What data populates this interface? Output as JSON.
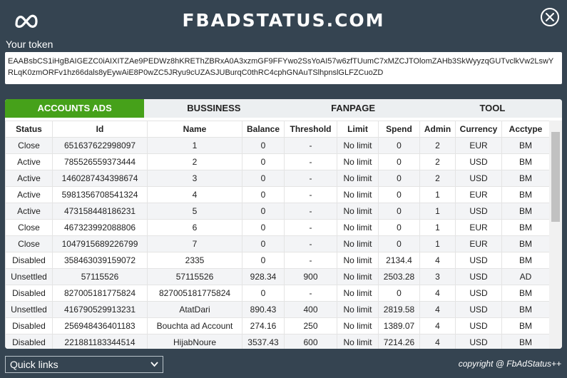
{
  "app": {
    "title": "FBADSTATUS.COM"
  },
  "token": {
    "label": "Your token",
    "value": "EAABsbCS1iHgBAIGEZC0iAIXITZAe9PEDWz8hKREThZBRxA0A3xzmGF9FFYwo2SsYoAI57w6zfTUumC7xMZCJTOlomZAHb3SkWyyzqGUTvclkVw2LswYRLqK0zmORFv1hz66dals8yEywAiE8P0wZC5JRyu9cUZASJUBurqC0thRC4cphGNAuTSlhpnslGLFZCuoZD"
  },
  "tabs": [
    "ACCOUNTS ADS",
    "BUSSINESS",
    "FANPAGE",
    "TOOL"
  ],
  "table": {
    "columns": [
      "Status",
      "Id",
      "Name",
      "Balance",
      "Threshold",
      "Limit",
      "Spend",
      "Admin",
      "Currency",
      "Acctype"
    ],
    "rows": [
      [
        "Close",
        "651637622998097",
        "1",
        "0",
        "-",
        "No limit",
        "0",
        "2",
        "EUR",
        "BM"
      ],
      [
        "Active",
        "785526559373444",
        "2",
        "0",
        "-",
        "No limit",
        "0",
        "2",
        "USD",
        "BM"
      ],
      [
        "Active",
        "1460287434398674",
        "3",
        "0",
        "-",
        "No limit",
        "0",
        "2",
        "USD",
        "BM"
      ],
      [
        "Active",
        "5981356708541324",
        "4",
        "0",
        "-",
        "No limit",
        "0",
        "1",
        "EUR",
        "BM"
      ],
      [
        "Active",
        "473158448186231",
        "5",
        "0",
        "-",
        "No limit",
        "0",
        "1",
        "USD",
        "BM"
      ],
      [
        "Close",
        "467323992088806",
        "6",
        "0",
        "-",
        "No limit",
        "0",
        "1",
        "EUR",
        "BM"
      ],
      [
        "Close",
        "1047915689226799",
        "7",
        "0",
        "-",
        "No limit",
        "0",
        "1",
        "EUR",
        "BM"
      ],
      [
        "Disabled",
        "358463039159072",
        "2335",
        "0",
        "-",
        "No limit",
        "2134.4",
        "4",
        "USD",
        "BM"
      ],
      [
        "Unsettled",
        "57115526",
        "57115526",
        "928.34",
        "900",
        "No limit",
        "2503.28",
        "3",
        "USD",
        "AD"
      ],
      [
        "Disabled",
        "827005181775824",
        "827005181775824",
        "0",
        "-",
        "No limit",
        "0",
        "4",
        "USD",
        "BM"
      ],
      [
        "Unsettled",
        "416790529913231",
        "AtatDari",
        "890.43",
        "400",
        "No limit",
        "2819.58",
        "4",
        "USD",
        "BM"
      ],
      [
        "Disabled",
        "256948436401183",
        "Bouchta ad Account",
        "274.16",
        "250",
        "No limit",
        "1389.07",
        "4",
        "USD",
        "BM"
      ],
      [
        "Disabled",
        "221881183344514",
        "HijabNoure",
        "3537.43",
        "600",
        "No limit",
        "7214.26",
        "4",
        "USD",
        "BM"
      ]
    ]
  },
  "footer": {
    "quick_links": "Quick links",
    "copyright": "copyright @ FbAdStatus++"
  },
  "colors": {
    "background": "#354451",
    "active_tab": "#46a11a"
  }
}
